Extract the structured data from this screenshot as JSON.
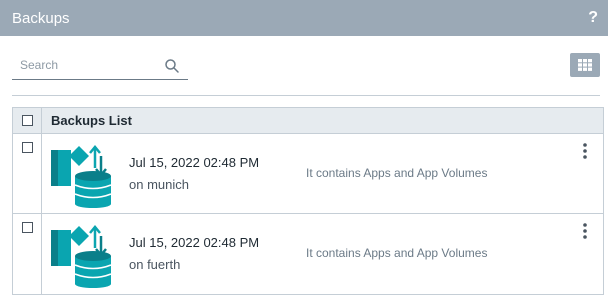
{
  "header": {
    "title": "Backups",
    "help_label": "?"
  },
  "search": {
    "placeholder": "Search",
    "value": ""
  },
  "toolbar": {
    "view_toggle_icon": "grid-view-icon"
  },
  "table": {
    "column_header": "Backups List",
    "rows": [
      {
        "date": "Jul 15, 2022 02:48 PM",
        "host": "on munich",
        "description": "It contains Apps and App Volumes"
      },
      {
        "date": "Jul 15, 2022 02:48 PM",
        "host": "on fuerth",
        "description": "It contains Apps and App Volumes"
      }
    ]
  },
  "colors": {
    "header_bg": "#9ba9b6",
    "icon_teal": "#0aa5b0",
    "icon_teal_dark": "#0a7f8a"
  }
}
